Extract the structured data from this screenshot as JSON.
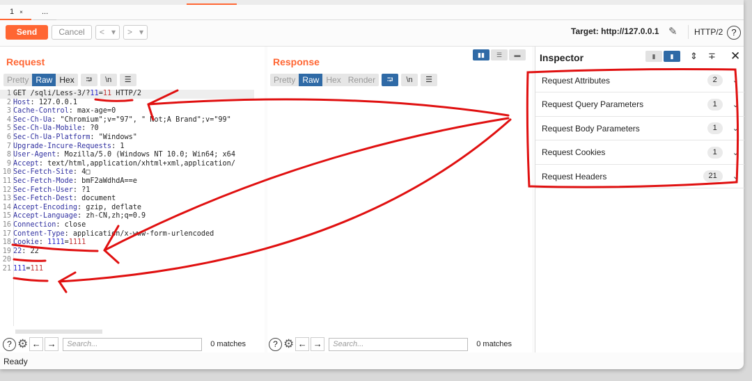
{
  "tabs": [
    {
      "label": "1",
      "close": "×"
    },
    {
      "label": "..."
    }
  ],
  "toolbar": {
    "send": "Send",
    "cancel": "Cancel",
    "back": "<",
    "forward": ">",
    "dropdown": "▾",
    "target": "Target: http://127.0.0.1",
    "protocol": "HTTP/2",
    "help": "?"
  },
  "request": {
    "title": "Request",
    "views": [
      "Pretty",
      "Raw",
      "Hex"
    ],
    "active_view": "Raw",
    "lines": [
      {
        "n": "1",
        "parts": [
          [
            "hv",
            "GET /sqli/Less-3/?"
          ],
          [
            "pn",
            "11"
          ],
          [
            "hv",
            "="
          ],
          [
            "pv",
            "11"
          ],
          [
            "hv",
            " HTTP/2"
          ]
        ]
      },
      {
        "n": "2",
        "parts": [
          [
            "hn",
            "Host"
          ],
          [
            "hv",
            ": 127.0.0.1"
          ]
        ]
      },
      {
        "n": "3",
        "parts": [
          [
            "hn",
            "Cache-Control"
          ],
          [
            "hv",
            ": max-age=0"
          ]
        ]
      },
      {
        "n": "4",
        "parts": [
          [
            "hn",
            "Sec-Ch-Ua"
          ],
          [
            "hv",
            ": \"Chromium\";v=\"97\", \" Not;A Brand\";v=\"99\""
          ]
        ]
      },
      {
        "n": "5",
        "parts": [
          [
            "hn",
            "Sec-Ch-Ua-Mobile"
          ],
          [
            "hv",
            ": ?0"
          ]
        ]
      },
      {
        "n": "6",
        "parts": [
          [
            "hn",
            "Sec-Ch-Ua-Platform"
          ],
          [
            "hv",
            ": \"Windows\""
          ]
        ]
      },
      {
        "n": "7",
        "parts": [
          [
            "hn",
            "Upgrade-Incure-Requests"
          ],
          [
            "hv",
            ": 1"
          ]
        ]
      },
      {
        "n": "8",
        "parts": [
          [
            "hn",
            "User-Agent"
          ],
          [
            "hv",
            ": Mozilla/5.0 (Windows NT 10.0; Win64; x64"
          ]
        ]
      },
      {
        "n": "9",
        "parts": [
          [
            "hn",
            "Accept"
          ],
          [
            "hv",
            ": text/html,application/xhtml+xml,application/"
          ]
        ]
      },
      {
        "n": "10",
        "parts": [
          [
            "hn",
            "Sec-Fetch-Site"
          ],
          [
            "hv",
            ": 4□"
          ]
        ]
      },
      {
        "n": "11",
        "parts": [
          [
            "hn",
            "Sec-Fetch-Mode"
          ],
          [
            "hv",
            ": bmF2aWdhdA==e"
          ]
        ]
      },
      {
        "n": "12",
        "parts": [
          [
            "hn",
            "Sec-Fetch-User"
          ],
          [
            "hv",
            ": ?1"
          ]
        ]
      },
      {
        "n": "13",
        "parts": [
          [
            "hn",
            "Sec-Fetch-Dest"
          ],
          [
            "hv",
            ": document"
          ]
        ]
      },
      {
        "n": "14",
        "parts": [
          [
            "hn",
            "Accept-Encoding"
          ],
          [
            "hv",
            ": gzip, deflate"
          ]
        ]
      },
      {
        "n": "15",
        "parts": [
          [
            "hn",
            "Accept-Language"
          ],
          [
            "hv",
            ": zh-CN,zh;q=0.9"
          ]
        ]
      },
      {
        "n": "16",
        "parts": [
          [
            "hn",
            "Connection"
          ],
          [
            "hv",
            ": close"
          ]
        ]
      },
      {
        "n": "17",
        "parts": [
          [
            "hn",
            "Content-Type"
          ],
          [
            "hv",
            ": application/x-www-form-urlencoded"
          ]
        ]
      },
      {
        "n": "18",
        "parts": [
          [
            "hn",
            "Cookie"
          ],
          [
            "hv",
            ": "
          ],
          [
            "pn",
            "1111"
          ],
          [
            "hv",
            "="
          ],
          [
            "pv",
            "1111"
          ]
        ]
      },
      {
        "n": "19",
        "parts": [
          [
            "hn",
            "22"
          ],
          [
            "hv",
            ": 22"
          ]
        ]
      },
      {
        "n": "20",
        "parts": []
      },
      {
        "n": "21",
        "parts": [
          [
            "pn",
            "111"
          ],
          [
            "hv",
            "="
          ],
          [
            "pv",
            "111"
          ]
        ]
      }
    ],
    "search_placeholder": "Search...",
    "matches": "0 matches"
  },
  "response": {
    "title": "Response",
    "views": [
      "Pretty",
      "Raw",
      "Hex",
      "Render"
    ],
    "active_view": "Raw",
    "search_placeholder": "Search...",
    "matches": "0 matches"
  },
  "inspector": {
    "title": "Inspector",
    "sections": [
      {
        "label": "Request Attributes",
        "count": "2"
      },
      {
        "label": "Request Query Parameters",
        "count": "1"
      },
      {
        "label": "Request Body Parameters",
        "count": "1"
      },
      {
        "label": "Request Cookies",
        "count": "1"
      },
      {
        "label": "Request Headers",
        "count": "21"
      }
    ]
  },
  "status": "Ready",
  "colors": {
    "accent": "#ff6633",
    "active_view": "#2f6aa6",
    "annotation": "#e01010"
  }
}
